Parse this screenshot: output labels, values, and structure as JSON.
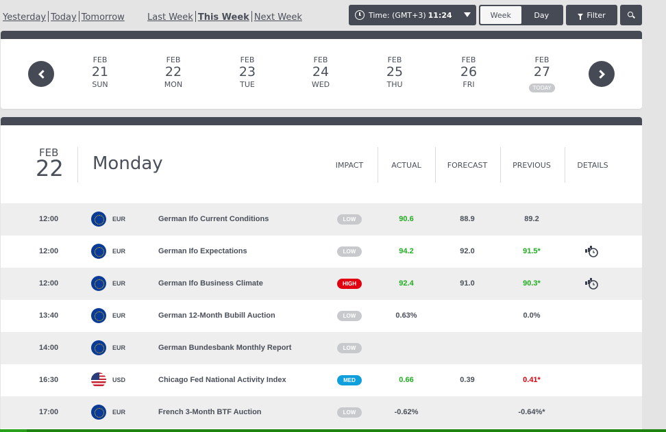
{
  "nav": {
    "day_links": [
      "Yesterday",
      "Today",
      "Tomorrow"
    ],
    "week_links": [
      "Last Week",
      "This Week",
      "Next Week"
    ],
    "active_week_link": "This Week"
  },
  "toolbar": {
    "timezone_label": "Time: (GMT+3)",
    "current_time": "11:24",
    "view_options": [
      "Week",
      "Day"
    ],
    "active_view": "Week",
    "filter_label": "Filter",
    "icons": {
      "time": "clock-icon",
      "dropdown": "caret-down-icon",
      "filter": "funnel-icon",
      "search": "search-icon"
    }
  },
  "week": {
    "days": [
      {
        "month": "FEB",
        "day": "21",
        "weekday": "SUN"
      },
      {
        "month": "FEB",
        "day": "22",
        "weekday": "MON"
      },
      {
        "month": "FEB",
        "day": "23",
        "weekday": "TUE"
      },
      {
        "month": "FEB",
        "day": "24",
        "weekday": "WED"
      },
      {
        "month": "FEB",
        "day": "25",
        "weekday": "THU"
      },
      {
        "month": "FEB",
        "day": "26",
        "weekday": "FRI"
      },
      {
        "month": "FEB",
        "day": "27",
        "weekday": "TODAY",
        "is_today": true
      }
    ],
    "icons": {
      "prev": "chevron-left-icon",
      "next": "chevron-right-icon"
    }
  },
  "day_panel": {
    "month": "FEB",
    "day": "22",
    "weekday_name": "Monday",
    "columns": [
      "IMPACT",
      "ACTUAL",
      "FORECAST",
      "PREVIOUS",
      "DETAILS"
    ]
  },
  "events": [
    {
      "time": "12:00",
      "currency": "EUR",
      "flag": "eu-flag",
      "event": "German Ifo Current Conditions",
      "impact": "LOW",
      "actual": "90.6",
      "actual_color": "green",
      "forecast": "88.9",
      "previous": "89.2",
      "previous_color": "",
      "has_details": false
    },
    {
      "time": "12:00",
      "currency": "EUR",
      "flag": "eu-flag",
      "event": "German Ifo Expectations",
      "impact": "LOW",
      "actual": "94.2",
      "actual_color": "green",
      "forecast": "92.0",
      "previous": "91.5*",
      "previous_color": "green",
      "has_details": true
    },
    {
      "time": "12:00",
      "currency": "EUR",
      "flag": "eu-flag",
      "event": "German Ifo Business Climate",
      "impact": "HIGH",
      "actual": "92.4",
      "actual_color": "green",
      "forecast": "91.0",
      "previous": "90.3*",
      "previous_color": "green",
      "has_details": true
    },
    {
      "time": "13:40",
      "currency": "EUR",
      "flag": "eu-flag",
      "event": "German 12-Month Bubill Auction",
      "impact": "LOW",
      "actual": "0.63%",
      "actual_color": "",
      "forecast": "",
      "previous": "0.0%",
      "previous_color": "",
      "has_details": false
    },
    {
      "time": "14:00",
      "currency": "EUR",
      "flag": "eu-flag",
      "event": "German Bundesbank Monthly Report",
      "impact": "LOW",
      "actual": "",
      "actual_color": "",
      "forecast": "",
      "previous": "",
      "previous_color": "",
      "has_details": false
    },
    {
      "time": "16:30",
      "currency": "USD",
      "flag": "us-flag",
      "event": "Chicago Fed National Activity Index",
      "impact": "MED",
      "actual": "0.66",
      "actual_color": "green",
      "forecast": "0.39",
      "previous": "0.41*",
      "previous_color": "red",
      "has_details": false
    },
    {
      "time": "17:00",
      "currency": "EUR",
      "flag": "eu-flag",
      "event": "French 3-Month BTF Auction",
      "impact": "LOW",
      "actual": "-0.62%",
      "actual_color": "",
      "forecast": "",
      "previous": "-0.64%*",
      "previous_color": "",
      "has_details": false
    }
  ],
  "colors": {
    "dark": "#454a54",
    "text": "#4a4f5a",
    "positive": "#1fae1f",
    "negative": "#e0000f",
    "impact_low": "#c7c9cd",
    "impact_med": "#109fdd",
    "impact_high": "#e0000f",
    "bottom_bar": "#1e8210"
  }
}
